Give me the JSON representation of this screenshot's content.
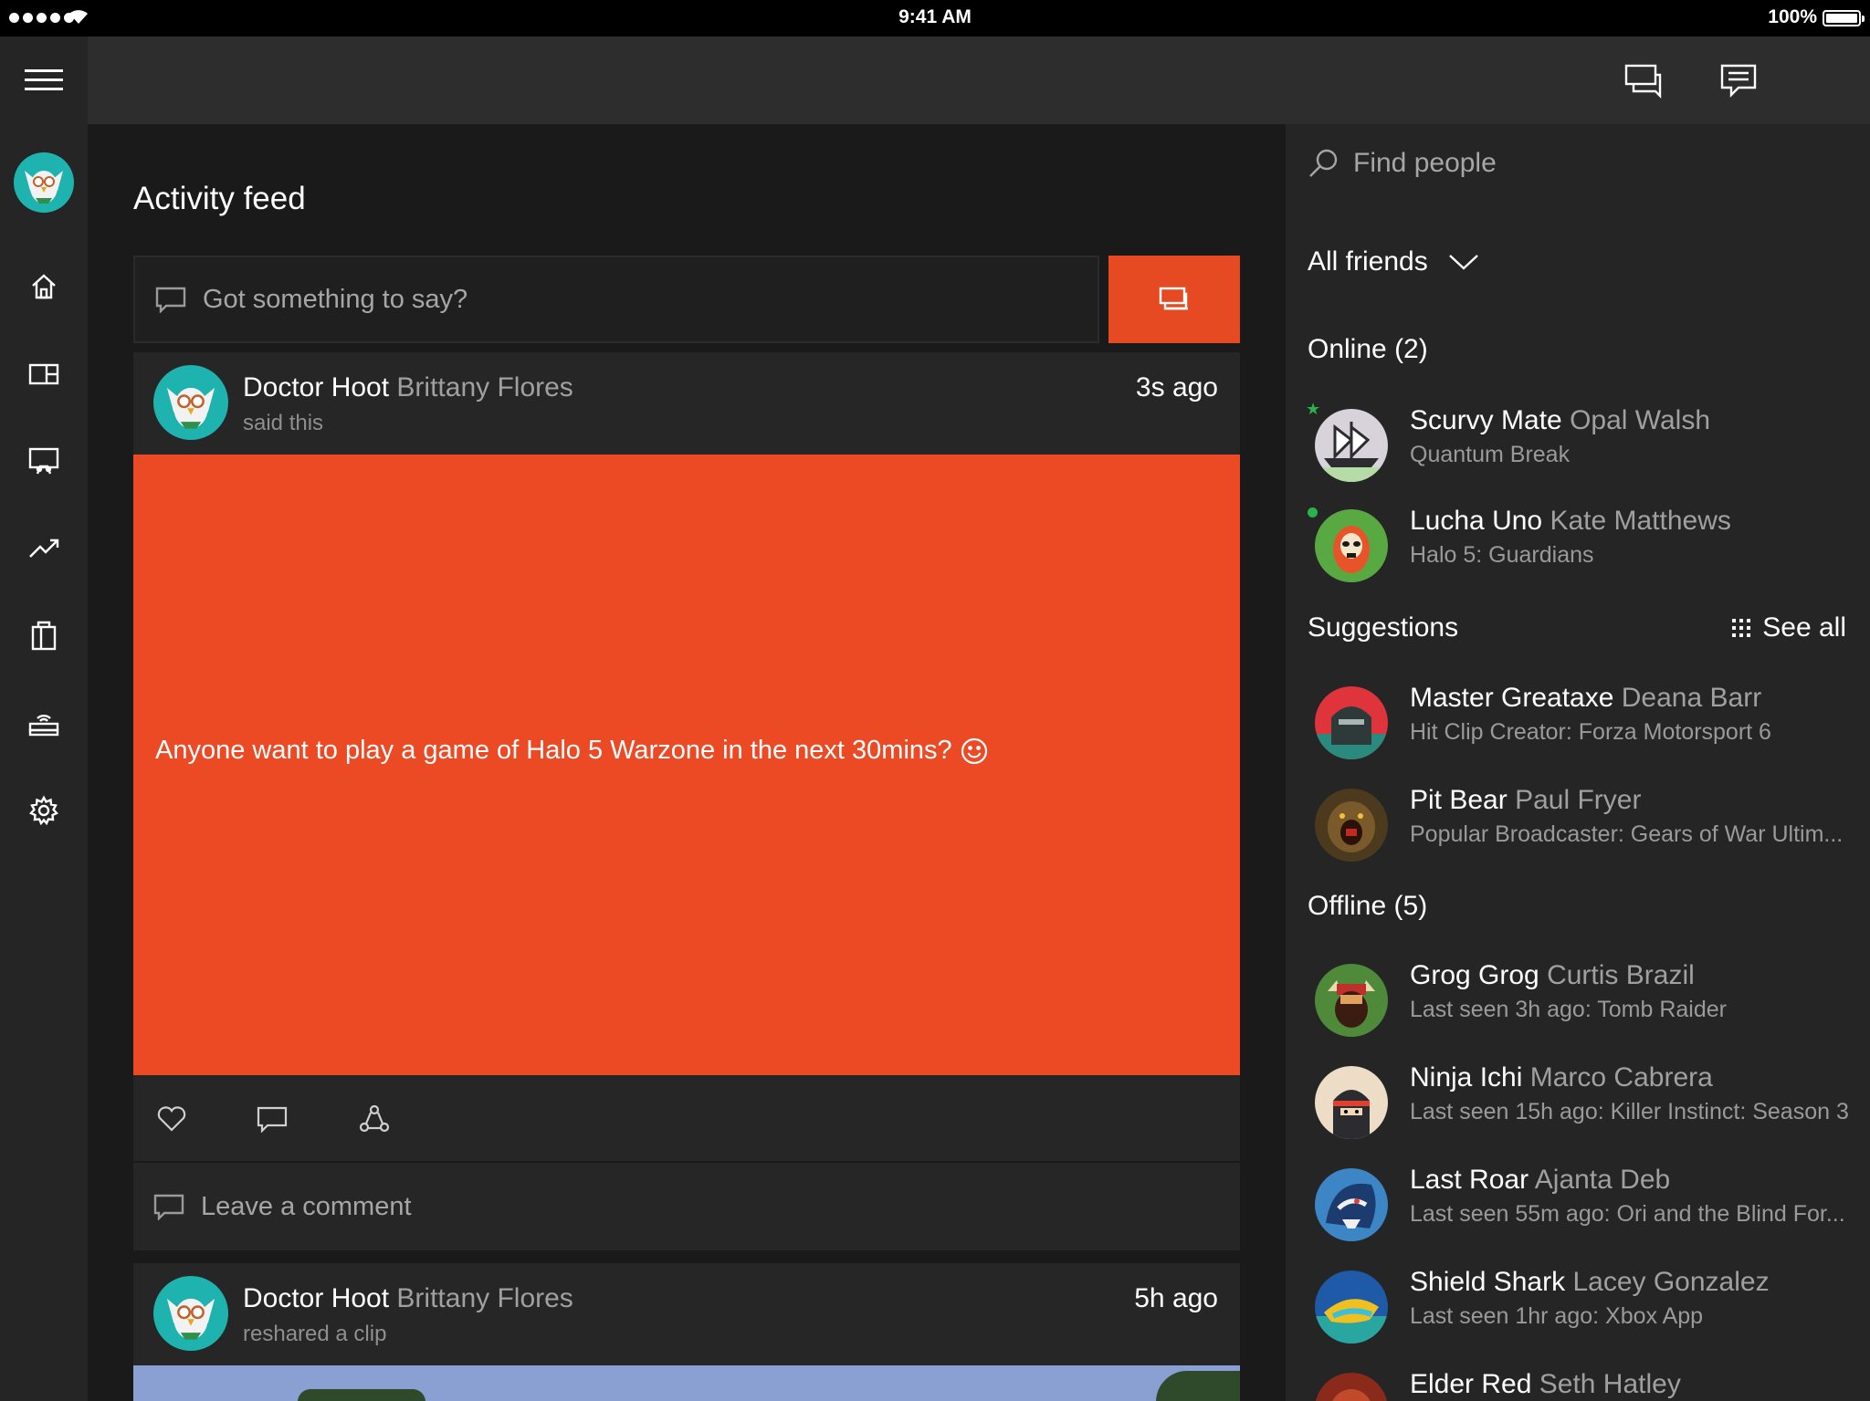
{
  "status_bar": {
    "time": "9:41 AM",
    "battery": "100%"
  },
  "nav": {
    "items": [
      {
        "icon": "home-icon"
      },
      {
        "icon": "store-icon"
      },
      {
        "icon": "game-dvr-icon"
      },
      {
        "icon": "trending-icon"
      },
      {
        "icon": "bag-icon"
      },
      {
        "icon": "console-icon"
      },
      {
        "icon": "settings-icon"
      }
    ]
  },
  "feed": {
    "title": "Activity feed",
    "composer_placeholder": "Got something to say?",
    "posts": [
      {
        "gamertag": "Doctor Hoot",
        "real_name": "Brittany Flores",
        "action": "said this",
        "time": "3s ago",
        "message": "Anyone want to play a game of Halo 5 Warzone in the next 30mins?",
        "comment_placeholder": "Leave a comment"
      },
      {
        "gamertag": "Doctor Hoot",
        "real_name": "Brittany Flores",
        "action": "reshared a clip",
        "time": "5h ago"
      }
    ]
  },
  "colors": {
    "accent": "#e64a22",
    "online": "#2bb24c",
    "panel": "#252526",
    "background": "#1a1a1b"
  },
  "friends": {
    "search_placeholder": "Find people",
    "filter": "All friends",
    "online": {
      "label": "Online",
      "count": "(2)",
      "people": [
        {
          "gamertag": "Scurvy Mate",
          "real_name": "Opal Walsh",
          "status": "Quantum Break"
        },
        {
          "gamertag": "Lucha Uno",
          "real_name": "Kate Matthews",
          "status": "Halo 5: Guardians"
        }
      ]
    },
    "suggestions": {
      "label": "Suggestions",
      "see_all": "See all",
      "people": [
        {
          "gamertag": "Master Greataxe",
          "real_name": "Deana Barr",
          "status": "Hit Clip Creator: Forza Motorsport 6"
        },
        {
          "gamertag": "Pit Bear",
          "real_name": "Paul Fryer",
          "status": "Popular Broadcaster: Gears of War Ultim..."
        }
      ]
    },
    "offline": {
      "label": "Offline",
      "count": "(5)",
      "people": [
        {
          "gamertag": "Grog Grog",
          "real_name": "Curtis Brazil",
          "status": "Last seen 3h ago: Tomb Raider"
        },
        {
          "gamertag": "Ninja Ichi",
          "real_name": "Marco Cabrera",
          "status": "Last seen 15h ago: Killer Instinct: Season 3"
        },
        {
          "gamertag": "Last Roar",
          "real_name": "Ajanta Deb",
          "status": "Last seen 55m ago: Ori and the Blind For..."
        },
        {
          "gamertag": "Shield Shark",
          "real_name": "Lacey Gonzalez",
          "status": "Last seen 1hr ago: Xbox App"
        },
        {
          "gamertag": "Elder Red",
          "real_name": "Seth Hatley",
          "status": ""
        }
      ]
    }
  }
}
